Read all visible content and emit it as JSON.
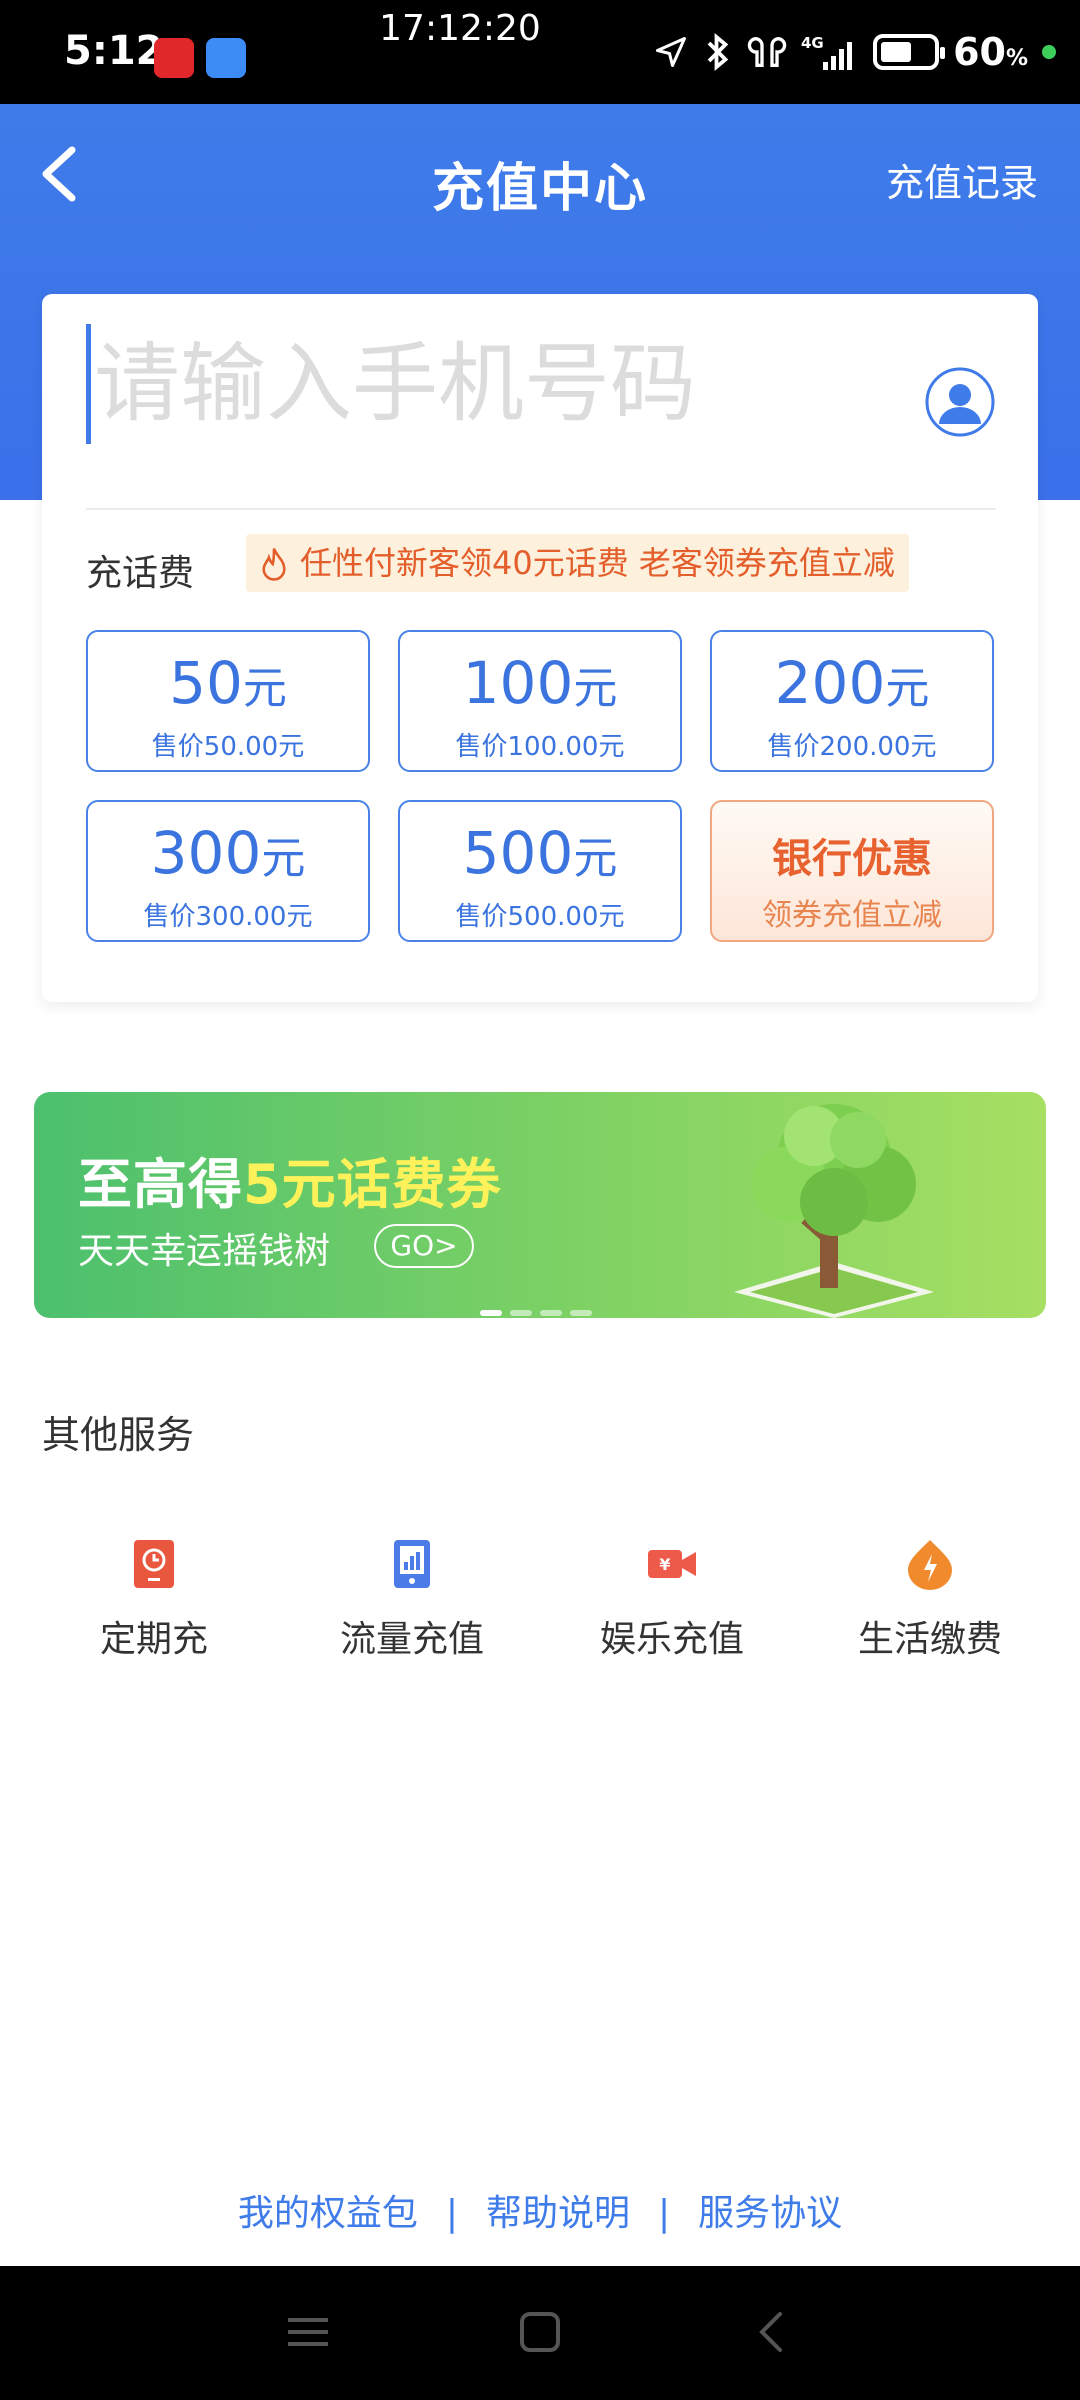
{
  "status_bar": {
    "time": "5:12",
    "center_time": "17:12:20",
    "network": "4G",
    "battery_percent": "60",
    "battery_unit": "%",
    "battery_level": 0.6
  },
  "header": {
    "title": "充值中心",
    "record_label": "充值记录"
  },
  "recharge": {
    "phone_placeholder": "请输入手机号码",
    "fee_label": "充话费",
    "promo_text": "任性付新客领40元话费 老客领券充值立减",
    "options": [
      {
        "amount": "50",
        "unit": "元",
        "price": "售价50.00元"
      },
      {
        "amount": "100",
        "unit": "元",
        "price": "售价100.00元"
      },
      {
        "amount": "200",
        "unit": "元",
        "price": "售价200.00元"
      },
      {
        "amount": "300",
        "unit": "元",
        "price": "售价300.00元"
      },
      {
        "amount": "500",
        "unit": "元",
        "price": "售价500.00元"
      }
    ],
    "bank": {
      "title": "银行优惠",
      "subtitle": "领券充值立减"
    }
  },
  "banner": {
    "title_prefix": "至高得",
    "title_highlight": "5元话费券",
    "subtitle": "天天幸运摇钱树",
    "go_label": "GO>",
    "pages": 4,
    "active_page": 0
  },
  "services": {
    "title": "其他服务",
    "items": [
      {
        "label": "定期充",
        "icon": "scheduled-recharge-icon",
        "color": "#e9573f"
      },
      {
        "label": "流量充值",
        "icon": "data-recharge-icon",
        "color": "#4a7be6"
      },
      {
        "label": "娱乐充值",
        "icon": "entertainment-recharge-icon",
        "color": "#ee5a4a"
      },
      {
        "label": "生活缴费",
        "icon": "utility-bill-icon",
        "color": "#f08a2c"
      }
    ]
  },
  "footer": {
    "links": [
      "我的权益包",
      "帮助说明",
      "服务协议"
    ],
    "separator": "|"
  },
  "colors": {
    "brand_blue": "#3f7ce9",
    "promo_orange": "#e35e2a",
    "banner_green": "#4cc06e"
  }
}
